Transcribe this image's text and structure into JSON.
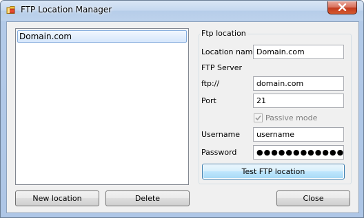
{
  "window": {
    "title": "FTP Location Manager"
  },
  "locations": {
    "items": [
      "Domain.com"
    ]
  },
  "form": {
    "group_title": "Ftp location",
    "location_name_label": "Location name",
    "location_name_value": "Domain.com",
    "ftp_server_label": "FTP Server",
    "ftp_prefix_label": "ftp://",
    "host_value": "domain.com",
    "port_label": "Port",
    "port_value": "21",
    "passive_mode_label": "Passive mode",
    "passive_mode_checked": true,
    "username_label": "Username",
    "username_value": "username",
    "password_label": "Password",
    "password_value": "●●●●●●●●●●●●",
    "test_button_label": "Test FTP location"
  },
  "buttons": {
    "new_location_label": "New location",
    "delete_label": "Delete",
    "close_label": "Close"
  },
  "icons": {
    "app": "ftp-folder-icon",
    "close": "close-icon",
    "check": "check-icon"
  },
  "colors": {
    "close_button": "#c33c1f",
    "selection": "#84acdd",
    "default_button_border": "#3c7fb1"
  }
}
